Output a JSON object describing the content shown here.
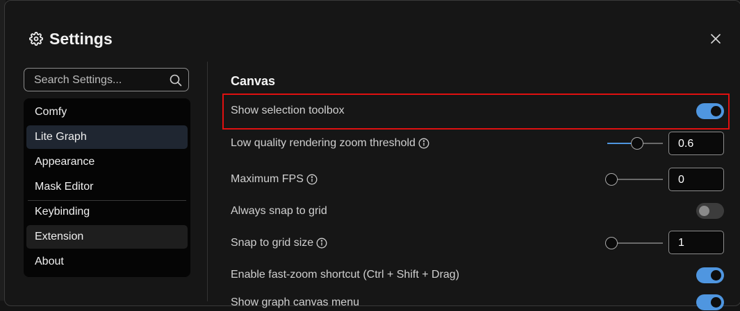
{
  "dialog": {
    "title": "Settings",
    "search_placeholder": "Search Settings..."
  },
  "nav": {
    "items": [
      {
        "label": "Comfy",
        "state": "normal"
      },
      {
        "label": "Lite Graph",
        "state": "selected"
      },
      {
        "label": "Appearance",
        "state": "normal"
      },
      {
        "label": "Mask Editor",
        "state": "normal"
      },
      {
        "label": "Keybinding",
        "state": "normal"
      },
      {
        "label": "Extension",
        "state": "hover"
      },
      {
        "label": "About",
        "state": "normal"
      }
    ]
  },
  "section": {
    "title": "Canvas",
    "settings": [
      {
        "label": "Show selection toolbox",
        "control": "toggle",
        "on": true,
        "highlighted": true
      },
      {
        "label": "Low quality rendering zoom threshold",
        "control": "slider",
        "value": "0.6",
        "slider_fraction": 0.55,
        "info": true
      },
      {
        "label": "Maximum FPS",
        "control": "slider",
        "value": "0",
        "slider_fraction": 0.0,
        "info": true
      },
      {
        "label": "Always snap to grid",
        "control": "toggle",
        "on": false
      },
      {
        "label": "Snap to grid size",
        "control": "slider",
        "value": "1",
        "slider_fraction": 0.0,
        "info": true
      },
      {
        "label": "Enable fast-zoom shortcut (Ctrl + Shift + Drag)",
        "control": "toggle",
        "on": true
      },
      {
        "label": "Show graph canvas menu",
        "control": "toggle",
        "on": true
      }
    ]
  },
  "colors": {
    "accent": "#4f96e0",
    "highlight_border": "#e01010",
    "selected_nav": "#1f2631"
  }
}
